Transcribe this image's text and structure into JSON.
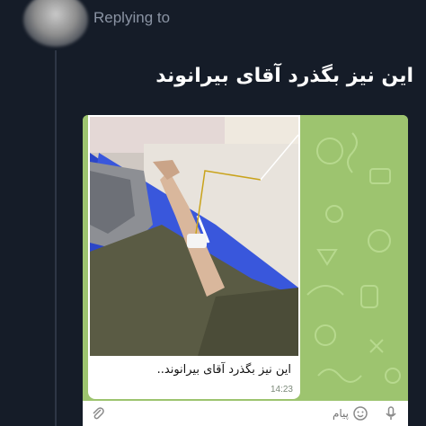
{
  "reply": {
    "label": "Replying to"
  },
  "tweet": {
    "text": "این نیز بگذرد آقای بیرانوند"
  },
  "telegram": {
    "caption": "این نیز بگذرد آقای بیرانوند..",
    "time": "14:23",
    "input_placeholder": "پیام",
    "icons": {
      "attach": "paperclip-icon",
      "emoji": "emoji-icon",
      "mic": "microphone-icon"
    }
  },
  "colors": {
    "background": "#151c28",
    "telegram_pattern": "#9cc26e",
    "reply_text": "#8a93a3"
  }
}
